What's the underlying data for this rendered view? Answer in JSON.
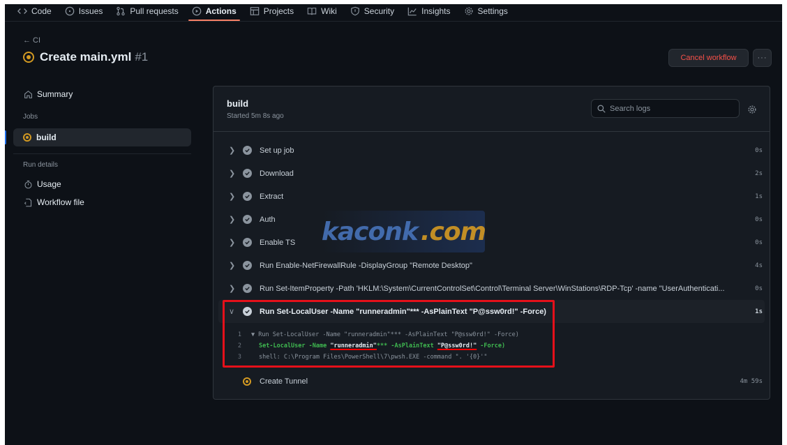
{
  "nav": {
    "tabs": [
      {
        "label": "Code",
        "icon": "code-icon",
        "active": false
      },
      {
        "label": "Issues",
        "icon": "issue-icon",
        "active": false
      },
      {
        "label": "Pull requests",
        "icon": "pull-request-icon",
        "active": false
      },
      {
        "label": "Actions",
        "icon": "play-icon",
        "active": true
      },
      {
        "label": "Projects",
        "icon": "table-icon",
        "active": false
      },
      {
        "label": "Wiki",
        "icon": "book-icon",
        "active": false
      },
      {
        "label": "Security",
        "icon": "shield-icon",
        "active": false
      },
      {
        "label": "Insights",
        "icon": "graph-icon",
        "active": false
      },
      {
        "label": "Settings",
        "icon": "gear-icon",
        "active": false
      }
    ]
  },
  "header": {
    "back_label": "← CI",
    "title": "Create main.yml",
    "run_number": "#1",
    "cancel_label": "Cancel workflow",
    "more_label": "···"
  },
  "sidebar": {
    "summary_label": "Summary",
    "jobs_heading": "Jobs",
    "job_label": "build",
    "run_details_heading": "Run details",
    "usage_label": "Usage",
    "workflow_file_label": "Workflow file"
  },
  "job": {
    "name": "build",
    "started": "Started 5m 8s ago",
    "search_placeholder": "Search logs"
  },
  "steps": [
    {
      "label": "Set up job",
      "duration": "0s"
    },
    {
      "label": "Download",
      "duration": "2s"
    },
    {
      "label": "Extract",
      "duration": "1s"
    },
    {
      "label": "Auth",
      "duration": "0s"
    },
    {
      "label": "Enable TS",
      "duration": "0s"
    },
    {
      "label": "Run Enable-NetFirewallRule -DisplayGroup \"Remote Desktop\"",
      "duration": "4s"
    },
    {
      "label": "Run Set-ItemProperty -Path 'HKLM:\\System\\CurrentControlSet\\Control\\Terminal Server\\WinStations\\RDP-Tcp' -name \"UserAuthenticati...",
      "duration": "0s"
    }
  ],
  "expanded_step": {
    "label": "Run Set-LocalUser -Name \"runneradmin\"*** -AsPlainText \"P@ssw0rd!\" -Force)",
    "duration": "1s",
    "log": [
      {
        "num": "1",
        "text": "▼ Run Set-LocalUser -Name \"runneradmin\"*** -AsPlainText \"P@ssw0rd!\" -Force)"
      },
      {
        "num": "2",
        "prefix": "Set-LocalUser -Name ",
        "user": "\"runneradmin\"",
        "mid": "*** -AsPlainText ",
        "password": "\"P@ssw0rd!\"",
        "suffix": " -Force)"
      },
      {
        "num": "3",
        "text": "shell: C:\\Program Files\\PowerShell\\7\\pwsh.EXE -command \". '{0}'\""
      }
    ]
  },
  "running_step": {
    "label": "Create Tunnel",
    "duration": "4m 59s"
  },
  "watermark": {
    "text_main": "kaconk",
    "text_suffix": ".com"
  },
  "colors": {
    "accent_tab": "#f78166",
    "in_progress": "#d29922",
    "danger": "#f85149",
    "highlight_box": "#e5101a"
  }
}
